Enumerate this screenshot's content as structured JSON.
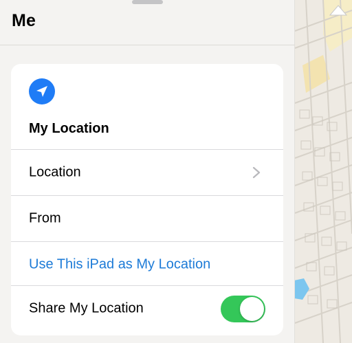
{
  "sheet": {
    "title": "Me"
  },
  "card": {
    "icon": "location-arrow-icon",
    "heading": "My Location",
    "rows": [
      {
        "label": "Location",
        "accessory": "chevron-right-icon"
      },
      {
        "label": "From"
      },
      {
        "label": "Use This iPad as My Location",
        "style": "link"
      },
      {
        "label": "Share My Location",
        "toggle": true
      }
    ]
  },
  "colors": {
    "accent": "#1d7bd7",
    "location_badge": "#1f7cf6",
    "toggle_on": "#34c759"
  }
}
